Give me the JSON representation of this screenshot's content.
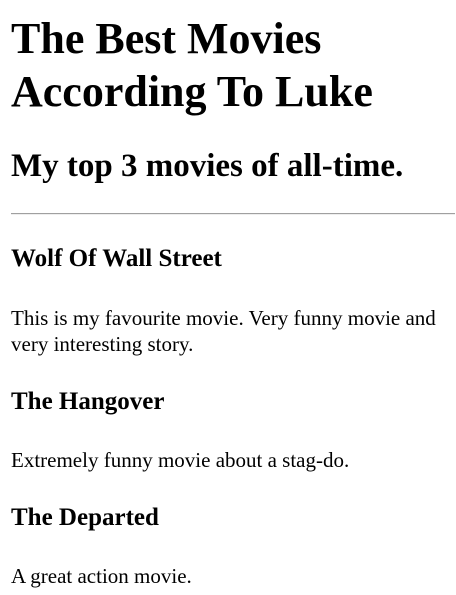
{
  "header": {
    "title": "The Best Movies According To Luke",
    "subtitle": "My top 3 movies of all-time."
  },
  "movies": [
    {
      "title": "Wolf Of Wall Street",
      "description": "This is my favourite movie. Very funny movie and very interesting story."
    },
    {
      "title": "The Hangover",
      "description": "Extremely funny movie about a stag-do."
    },
    {
      "title": "The Departed",
      "description": "A great action movie."
    }
  ]
}
